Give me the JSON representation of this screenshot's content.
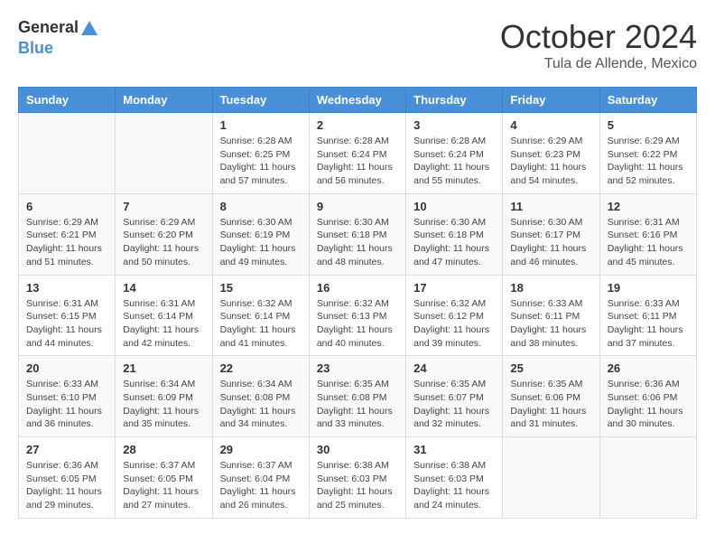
{
  "header": {
    "logo_general": "General",
    "logo_blue": "Blue",
    "month": "October 2024",
    "location": "Tula de Allende, Mexico"
  },
  "weekdays": [
    "Sunday",
    "Monday",
    "Tuesday",
    "Wednesday",
    "Thursday",
    "Friday",
    "Saturday"
  ],
  "weeks": [
    [
      {
        "day": "",
        "info": ""
      },
      {
        "day": "",
        "info": ""
      },
      {
        "day": "1",
        "info": "Sunrise: 6:28 AM\nSunset: 6:25 PM\nDaylight: 11 hours and 57 minutes."
      },
      {
        "day": "2",
        "info": "Sunrise: 6:28 AM\nSunset: 6:24 PM\nDaylight: 11 hours and 56 minutes."
      },
      {
        "day": "3",
        "info": "Sunrise: 6:28 AM\nSunset: 6:24 PM\nDaylight: 11 hours and 55 minutes."
      },
      {
        "day": "4",
        "info": "Sunrise: 6:29 AM\nSunset: 6:23 PM\nDaylight: 11 hours and 54 minutes."
      },
      {
        "day": "5",
        "info": "Sunrise: 6:29 AM\nSunset: 6:22 PM\nDaylight: 11 hours and 52 minutes."
      }
    ],
    [
      {
        "day": "6",
        "info": "Sunrise: 6:29 AM\nSunset: 6:21 PM\nDaylight: 11 hours and 51 minutes."
      },
      {
        "day": "7",
        "info": "Sunrise: 6:29 AM\nSunset: 6:20 PM\nDaylight: 11 hours and 50 minutes."
      },
      {
        "day": "8",
        "info": "Sunrise: 6:30 AM\nSunset: 6:19 PM\nDaylight: 11 hours and 49 minutes."
      },
      {
        "day": "9",
        "info": "Sunrise: 6:30 AM\nSunset: 6:18 PM\nDaylight: 11 hours and 48 minutes."
      },
      {
        "day": "10",
        "info": "Sunrise: 6:30 AM\nSunset: 6:18 PM\nDaylight: 11 hours and 47 minutes."
      },
      {
        "day": "11",
        "info": "Sunrise: 6:30 AM\nSunset: 6:17 PM\nDaylight: 11 hours and 46 minutes."
      },
      {
        "day": "12",
        "info": "Sunrise: 6:31 AM\nSunset: 6:16 PM\nDaylight: 11 hours and 45 minutes."
      }
    ],
    [
      {
        "day": "13",
        "info": "Sunrise: 6:31 AM\nSunset: 6:15 PM\nDaylight: 11 hours and 44 minutes."
      },
      {
        "day": "14",
        "info": "Sunrise: 6:31 AM\nSunset: 6:14 PM\nDaylight: 11 hours and 42 minutes."
      },
      {
        "day": "15",
        "info": "Sunrise: 6:32 AM\nSunset: 6:14 PM\nDaylight: 11 hours and 41 minutes."
      },
      {
        "day": "16",
        "info": "Sunrise: 6:32 AM\nSunset: 6:13 PM\nDaylight: 11 hours and 40 minutes."
      },
      {
        "day": "17",
        "info": "Sunrise: 6:32 AM\nSunset: 6:12 PM\nDaylight: 11 hours and 39 minutes."
      },
      {
        "day": "18",
        "info": "Sunrise: 6:33 AM\nSunset: 6:11 PM\nDaylight: 11 hours and 38 minutes."
      },
      {
        "day": "19",
        "info": "Sunrise: 6:33 AM\nSunset: 6:11 PM\nDaylight: 11 hours and 37 minutes."
      }
    ],
    [
      {
        "day": "20",
        "info": "Sunrise: 6:33 AM\nSunset: 6:10 PM\nDaylight: 11 hours and 36 minutes."
      },
      {
        "day": "21",
        "info": "Sunrise: 6:34 AM\nSunset: 6:09 PM\nDaylight: 11 hours and 35 minutes."
      },
      {
        "day": "22",
        "info": "Sunrise: 6:34 AM\nSunset: 6:08 PM\nDaylight: 11 hours and 34 minutes."
      },
      {
        "day": "23",
        "info": "Sunrise: 6:35 AM\nSunset: 6:08 PM\nDaylight: 11 hours and 33 minutes."
      },
      {
        "day": "24",
        "info": "Sunrise: 6:35 AM\nSunset: 6:07 PM\nDaylight: 11 hours and 32 minutes."
      },
      {
        "day": "25",
        "info": "Sunrise: 6:35 AM\nSunset: 6:06 PM\nDaylight: 11 hours and 31 minutes."
      },
      {
        "day": "26",
        "info": "Sunrise: 6:36 AM\nSunset: 6:06 PM\nDaylight: 11 hours and 30 minutes."
      }
    ],
    [
      {
        "day": "27",
        "info": "Sunrise: 6:36 AM\nSunset: 6:05 PM\nDaylight: 11 hours and 29 minutes."
      },
      {
        "day": "28",
        "info": "Sunrise: 6:37 AM\nSunset: 6:05 PM\nDaylight: 11 hours and 27 minutes."
      },
      {
        "day": "29",
        "info": "Sunrise: 6:37 AM\nSunset: 6:04 PM\nDaylight: 11 hours and 26 minutes."
      },
      {
        "day": "30",
        "info": "Sunrise: 6:38 AM\nSunset: 6:03 PM\nDaylight: 11 hours and 25 minutes."
      },
      {
        "day": "31",
        "info": "Sunrise: 6:38 AM\nSunset: 6:03 PM\nDaylight: 11 hours and 24 minutes."
      },
      {
        "day": "",
        "info": ""
      },
      {
        "day": "",
        "info": ""
      }
    ]
  ]
}
